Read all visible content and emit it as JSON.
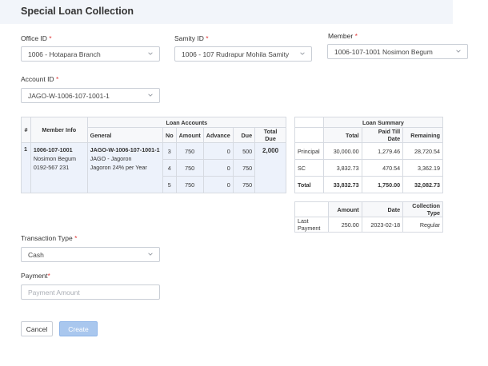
{
  "page": {
    "title": "Special Loan Collection"
  },
  "form": {
    "office": {
      "label": "Office ID",
      "required": "*",
      "value": "1006 - Hotapara Branch"
    },
    "samity": {
      "label": "Samity ID",
      "required": "*",
      "value": "1006 - 107 Rudrapur Mohila Samity"
    },
    "member": {
      "label": "Member",
      "required": "*",
      "value": "1006-107-1001 Nosimon Begum"
    },
    "account": {
      "label": "Account ID",
      "required": "*",
      "value": "JAGO-W-1006-107-1001-1"
    },
    "transaction_type": {
      "label": "Transaction Type",
      "required": "*",
      "value": "Cash"
    },
    "payment": {
      "label": "Payment",
      "required": "*",
      "placeholder": "Payment Amount"
    }
  },
  "loan_accounts": {
    "col_hash": "#",
    "col_member_info": "Member Info",
    "col_group": "Loan Accounts",
    "col_general": "General",
    "col_no": "No",
    "col_amount": "Amount",
    "col_advance": "Advance",
    "col_due": "Due",
    "col_total_due": "Total Due",
    "row": {
      "index": "1",
      "member_code": "1006-107-1001",
      "member_name": "Nosimon Begum",
      "member_phone": "0192-567 231",
      "account_code": "JAGO-W-1006-107-1001-1",
      "product": "JAGO - Jagoron",
      "product_detail": "Jagoron 24% per Year",
      "total_due": "2,000"
    },
    "installments": [
      {
        "no": "3",
        "amount": "750",
        "advance": "0",
        "due": "500"
      },
      {
        "no": "4",
        "amount": "750",
        "advance": "0",
        "due": "750"
      },
      {
        "no": "5",
        "amount": "750",
        "advance": "0",
        "due": "750"
      }
    ]
  },
  "loan_summary": {
    "title": "Loan Summary",
    "col_total": "Total",
    "col_paid": "Paid Till Date",
    "col_remaining": "Remaining",
    "rows": [
      {
        "label": "Principal",
        "total": "30,000.00",
        "paid": "1,279.46",
        "remaining": "28,720.54"
      },
      {
        "label": "SC",
        "total": "3,832.73",
        "paid": "470.54",
        "remaining": "3,362.19"
      },
      {
        "label": "Total",
        "total": "33,832.73",
        "paid": "1,750.00",
        "remaining": "32,082.73"
      }
    ]
  },
  "last_payment": {
    "col_amount": "Amount",
    "col_date": "Date",
    "col_type": "Collection Type",
    "label": "Last Payment",
    "amount": "250.00",
    "date": "2023-02-18",
    "type": "Regular"
  },
  "buttons": {
    "cancel": "Cancel",
    "create": "Create"
  }
}
